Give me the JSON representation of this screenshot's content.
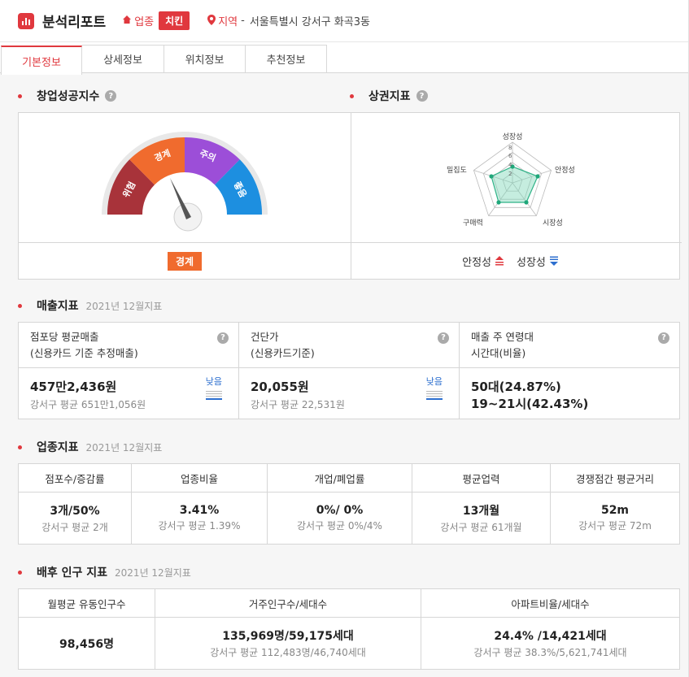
{
  "header": {
    "title": "분석리포트",
    "industry_label": "업종",
    "industry_value": "치킨",
    "region_label": "지역",
    "region_value": "서울특별시 강서구 화곡3동"
  },
  "tabs": [
    {
      "label": "기본정보",
      "active": true
    },
    {
      "label": "상세정보",
      "active": false
    },
    {
      "label": "위치정보",
      "active": false
    },
    {
      "label": "추천정보",
      "active": false
    }
  ],
  "success_index": {
    "title": "창업성공지수",
    "gauge_segments": [
      "위험",
      "경계",
      "주의",
      "좋음"
    ],
    "gauge_colors": [
      "#a8333a",
      "#f06b2e",
      "#9c4ed8",
      "#1d8fe0"
    ],
    "status": "경계"
  },
  "market_index": {
    "title": "상권지표",
    "axes": [
      "성장성",
      "안정성",
      "시장성",
      "구매력",
      "밀집도"
    ],
    "scale_ticks": [
      "8",
      "6",
      "4",
      "2"
    ],
    "trend": [
      {
        "label": "안정성",
        "direction": "up"
      },
      {
        "label": "성장성",
        "direction": "down"
      }
    ]
  },
  "sales": {
    "title": "매출지표",
    "date": "2021년 12월지표",
    "cells": [
      {
        "head1": "점포당 평균매출",
        "head2": "(신용카드 기준 추정매출)",
        "main": "457만2,436원",
        "sub": "강서구 평균 651만1,056원",
        "badge": "낮음"
      },
      {
        "head1": "건단가",
        "head2": "(신용카드기준)",
        "main": "20,055원",
        "sub": "강서구 평균 22,531원",
        "badge": "낮음"
      },
      {
        "head1": "매출 주 연령대",
        "head2": "시간대(비율)",
        "main": "50대(24.87%)",
        "sub": "19~21시(42.43%)",
        "badge": ""
      }
    ]
  },
  "industry": {
    "title": "업종지표",
    "date": "2021년 12월지표",
    "headers": [
      "점포수/증감률",
      "업종비율",
      "개업/폐업률",
      "평균업력",
      "경쟁점간 평균거리"
    ],
    "values": [
      {
        "main": "3개/50%",
        "sub": "강서구 평균 2개"
      },
      {
        "main": "3.41%",
        "sub": "강서구 평균 1.39%"
      },
      {
        "main": "0%/ 0%",
        "sub": "강서구 평균 0%/4%"
      },
      {
        "main": "13개월",
        "sub": "강서구 평균 61개월"
      },
      {
        "main": "52m",
        "sub": "강서구 평균 72m"
      }
    ]
  },
  "population": {
    "title": "배후 인구 지표",
    "date": "2021년 12월지표",
    "headers": [
      "월평균 유동인구수",
      "거주인구수/세대수",
      "아파트비율/세대수"
    ],
    "values": [
      {
        "main": "98,456명",
        "sub": ""
      },
      {
        "main": "135,969명/59,175세대",
        "sub": "강서구 평균 112,483명/46,740세대"
      },
      {
        "main": "24.4% /14,421세대",
        "sub": "강서구 평균 38.3%/5,621,741세대"
      }
    ]
  }
}
